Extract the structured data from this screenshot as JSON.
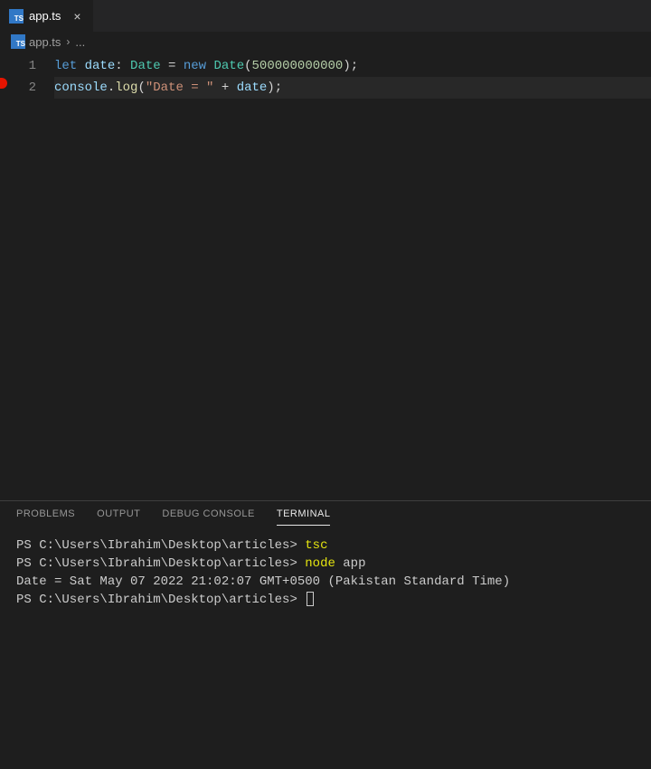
{
  "tab": {
    "filename": "app.ts",
    "close": "×"
  },
  "breadcrumb": {
    "file": "app.ts",
    "chevron": "›",
    "more": "..."
  },
  "editor": {
    "line_numbers": [
      "1",
      "2"
    ],
    "line1": {
      "let": "let",
      "var": " date",
      "colon": ": ",
      "type": "Date",
      "eq": " = ",
      "new": "new",
      "sp": " ",
      "ctor": "Date",
      "lp": "(",
      "num": "500000000000",
      "rp": ");"
    },
    "line2": {
      "obj": "console",
      "dot": ".",
      "fn": "log",
      "lp": "(",
      "str": "\"Date = \"",
      "plus": " + ",
      "var": "date",
      "rp": ");"
    }
  },
  "panel": {
    "tabs": {
      "problems": "PROBLEMS",
      "output": "OUTPUT",
      "debug": "DEBUG CONSOLE",
      "terminal": "TERMINAL"
    },
    "terminal": {
      "prompt": "PS C:\\Users\\Ibrahim\\Desktop\\articles>",
      "cmd1": "tsc",
      "cmd2_bin": "node",
      "cmd2_arg": " app",
      "output": "Date = Sat May 07 2022 21:02:07 GMT+0500 (Pakistan Standard Time)"
    }
  }
}
